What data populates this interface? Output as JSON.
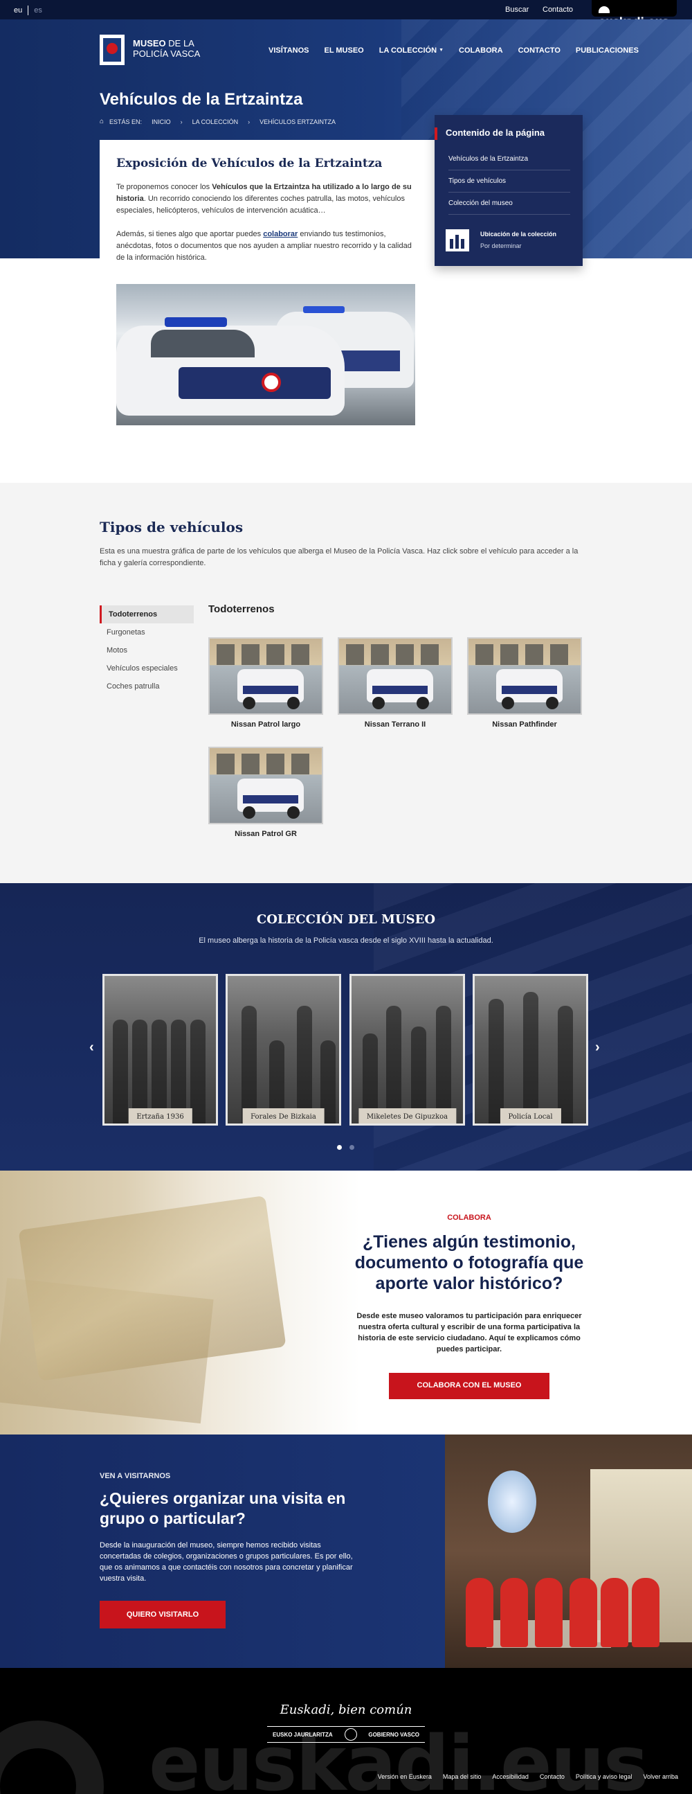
{
  "topbar": {
    "lang_active": "eu",
    "lang_other": "es",
    "search": "Buscar",
    "contact": "Contacto",
    "brand": "euskadi.eus"
  },
  "header": {
    "logo_line1_bold": "MUSEO",
    "logo_line1_rest": " DE LA",
    "logo_line2": "POLICÍA VASCA",
    "nav": [
      "VISÍTANOS",
      "EL MUSEO",
      "LA COLECCIÓN",
      "COLABORA",
      "CONTACTO",
      "PUBLICACIONES"
    ]
  },
  "page": {
    "title": "Vehículos de la Ertzaintza",
    "breadcrumb": [
      "ESTÁS EN:",
      "INICIO",
      "LA COLECCIÓN",
      "VEHÍCULOS ERTZAINTZA"
    ]
  },
  "intro": {
    "heading": "Exposición de Vehículos de la Ertzaintza",
    "p1_a": "Te proponemos conocer los ",
    "p1_bold": "Vehículos que la Ertzaintza ha utilizado a lo largo de su historia",
    "p1_b": ". Un recorrido conociendo los diferentes coches patrulla, las motos, vehículos especiales, helicópteros, vehículos de intervención acuática…",
    "p2_a": "Además, si tienes algo que aportar puedes ",
    "p2_link": "colaborar",
    "p2_b": " enviando tus testimonios, anécdotas, fotos o documentos que nos ayuden a ampliar nuestro recorrido y la calidad de la información histórica."
  },
  "toc": {
    "title": "Contenido de la página",
    "items": [
      "Vehículos de la Ertzaintza",
      "Tipos de vehículos",
      "Colección del museo"
    ],
    "location_label": "Ubicación de la colección",
    "location_value": "Por determinar"
  },
  "types": {
    "heading": "Tipos de vehículos",
    "intro": "Esta es una muestra gráfica de parte de los vehículos que alberga el Museo de la Policía Vasca. Haz click sobre el vehículo para acceder a la ficha y galería correspondiente.",
    "menu": [
      "Todoterrenos",
      "Furgonetas",
      "Motos",
      "Vehículos especiales",
      "Coches patrulla"
    ],
    "active_heading": "Todoterrenos",
    "vehicles": [
      "Nissan Patrol largo",
      "Nissan Terrano II",
      "Nissan Pathfinder",
      "Nissan Patrol GR"
    ]
  },
  "collection": {
    "heading": "COLECCIÓN DEL MUSEO",
    "subtitle": "El museo alberga la historia de la Policía vasca desde el siglo XVIII hasta la actualidad.",
    "items": [
      "Ertzaña 1936",
      "Forales De Bizkaia",
      "Mikeletes De Gipuzkoa",
      "Policía Local"
    ],
    "prev": "‹",
    "next": "›"
  },
  "colabora": {
    "kicker": "COLABORA",
    "heading": "¿Tienes algún testimonio, documento o fotografía que aporte valor histórico?",
    "text": "Desde este museo valoramos tu participación para enriquecer nuestra oferta cultural y escribir de una forma participativa la historia de este servicio ciudadano. Aquí te explicamos cómo puedes participar.",
    "button": "COLABORA CON EL MUSEO"
  },
  "visit": {
    "kicker": "VEN A VISITARNOS",
    "heading": "¿Quieres organizar una visita en grupo o particular?",
    "text": "Desde la inauguración del museo, siempre hemos recibido visitas concertadas de colegios, organizaciones o grupos particulares. Es por ello, que os animamos a que contactéis con nosotros para concretar y planificar vuestra visita.",
    "button": "QUIERO VISITARLO"
  },
  "footer": {
    "motto": "Euskadi, bien común",
    "gov_left": "EUSKO JAURLARITZA",
    "gov_right": "GOBIERNO VASCO",
    "watermark": "euskadi.eus",
    "links": [
      "Versión en Euskera",
      "Mapa del sitio",
      "Accesibilidad",
      "Contacto",
      "Política y aviso legal",
      "Volver arriba"
    ]
  },
  "colors": {
    "navy": "#1b2a5c",
    "red": "#c8141c"
  }
}
